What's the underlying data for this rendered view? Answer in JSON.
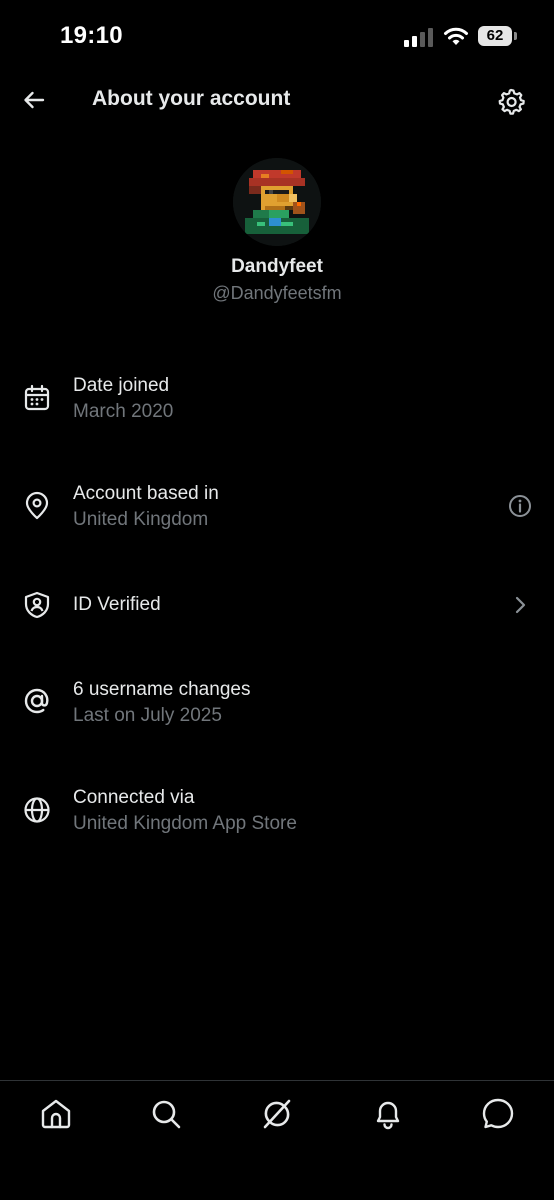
{
  "status_bar": {
    "time": "19:10",
    "battery": "62"
  },
  "header": {
    "title": "About your account"
  },
  "profile": {
    "display_name": "Dandyfeet",
    "handle": "@Dandyfeetsfm"
  },
  "info_items": [
    {
      "icon": "calendar-icon",
      "title": "Date joined",
      "subtitle": "March 2020"
    },
    {
      "icon": "location-pin-icon",
      "title": "Account based in",
      "subtitle": "United Kingdom",
      "right_icon": "info-icon"
    },
    {
      "icon": "shield-person-icon",
      "title": "ID Verified",
      "right_icon": "chevron-right-icon"
    },
    {
      "icon": "at-sign-icon",
      "title": "6 username changes",
      "subtitle": "Last on July 2025"
    },
    {
      "icon": "globe-icon",
      "title": "Connected via",
      "subtitle": "United Kingdom App Store"
    }
  ],
  "tab_bar": [
    "home-icon",
    "search-icon",
    "grok-icon",
    "notifications-icon",
    "messages-icon"
  ],
  "colors": {
    "background": "#000000",
    "primary_text": "#e7e9ea",
    "secondary_text": "#71767b",
    "divider": "#2f3336"
  }
}
